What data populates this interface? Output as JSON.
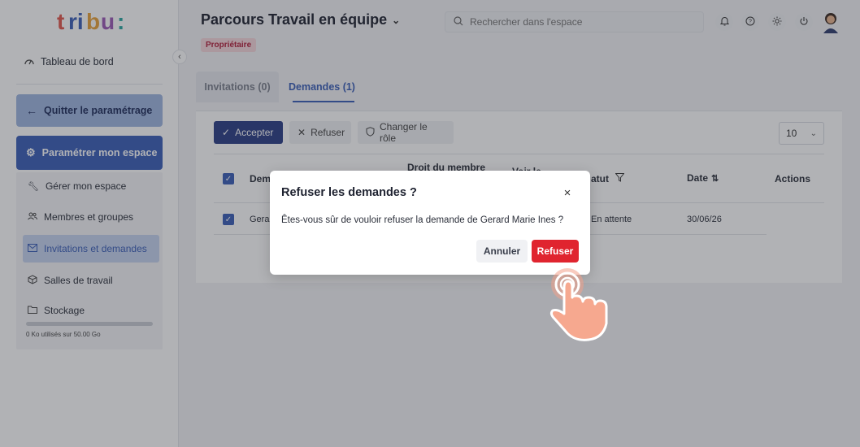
{
  "app": {
    "logo_text": "tribu:"
  },
  "sidebar": {
    "dashboard": "Tableau de bord",
    "quit_settings": "Quitter le paramétrage",
    "configure_space": "Paramétrer mon espace",
    "items": [
      {
        "label": "Gérer mon espace",
        "icon": "wrench-icon"
      },
      {
        "label": "Membres et groupes",
        "icon": "users-icon"
      },
      {
        "label": "Invitations et demandes",
        "icon": "mail-icon",
        "active": true
      },
      {
        "label": "Salles de travail",
        "icon": "box-icon"
      },
      {
        "label": "Stockage",
        "icon": "folder-icon"
      }
    ],
    "storage_used_fraction": 0,
    "storage_text": "0 Ko utilisés sur 50.00 Go"
  },
  "header": {
    "title": "Parcours Travail en équipe",
    "role": "Propriétaire",
    "search_placeholder": "Rechercher dans l'espace"
  },
  "tabs": [
    {
      "label": "Invitations (0)",
      "active": false
    },
    {
      "label": "Demandes (1)",
      "active": true
    }
  ],
  "toolbar": {
    "accept": "Accepter",
    "refuse": "Refuser",
    "change_role": "Changer le rôle",
    "page_size": "10"
  },
  "table": {
    "columns": {
      "member": "Dem",
      "role_right": "Droit du membre",
      "see": "Voir le",
      "status": "atut",
      "date": "Date",
      "actions": "Actions"
    },
    "rows": [
      {
        "member": "Gerar",
        "status": "En attente",
        "date": "30/06/26"
      }
    ]
  },
  "modal": {
    "title": "Refuser les demandes ?",
    "body": "Êtes-vous sûr de vouloir refuser la demande de Gerard Marie Ines ?",
    "cancel": "Annuler",
    "confirm": "Refuser"
  },
  "colors": {
    "primary": "#3a5eb8",
    "accent_dark": "#2b3d86",
    "danger": "#e0242f"
  }
}
